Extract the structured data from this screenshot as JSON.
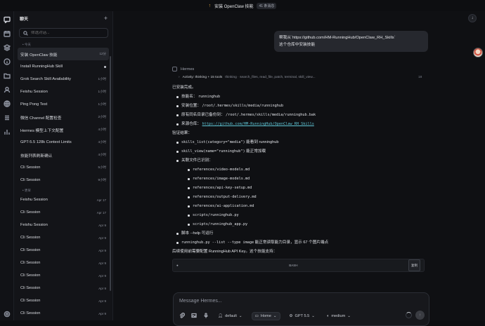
{
  "topbar": {
    "title": "安装 OpenClaw 技能",
    "count": "41 条消息",
    "warn_icon": "pin-icon"
  },
  "sidebar": {
    "title": "聊天",
    "new_label": "+",
    "search_placeholder": "筛选对话...",
    "groups": [
      {
        "label": "• 今天",
        "items": [
          {
            "label": "安装 OpenClaw 技能",
            "time": "12分",
            "selected": true
          },
          {
            "label": "Install RunningHub Skill",
            "time": "",
            "dot": true
          },
          {
            "label": "Grok Search Skill Availability",
            "time": "1小时"
          },
          {
            "label": "Feishu Session",
            "time": "1小时"
          },
          {
            "label": "Ping Pong Test",
            "time": "1小时"
          },
          {
            "label": "微信 Channel 配置检查",
            "time": "2小时"
          },
          {
            "label": "Hermes 模型上下文配置",
            "time": "4小时"
          },
          {
            "label": "GPT-5.5 128k Context Limits",
            "time": "4小时"
          },
          {
            "label": "技能列表刷新确认",
            "time": "4小时"
          },
          {
            "label": "Cli Session",
            "time": "5小时"
          },
          {
            "label": "Cli Session",
            "time": "9小时"
          }
        ]
      },
      {
        "label": "• 更早",
        "items": [
          {
            "label": "Feishu Session",
            "time": "Apr 17"
          },
          {
            "label": "Cli Session",
            "time": "Apr 17"
          },
          {
            "label": "Feishu Session",
            "time": "Apr 9"
          },
          {
            "label": "Cli Session",
            "time": "Apr 9"
          },
          {
            "label": "Cli Session",
            "time": "Apr 9"
          },
          {
            "label": "Cli Session",
            "time": "Apr 9"
          },
          {
            "label": "Cli Session",
            "time": "Apr 9"
          },
          {
            "label": "Cli Session",
            "time": "Apr 9"
          },
          {
            "label": "Cli Session",
            "time": "Apr 9"
          },
          {
            "label": "Cli Session",
            "time": "Apr 9"
          }
        ]
      }
    ]
  },
  "chat": {
    "user_message_line1": "帮我从`https://github.com/HM-RunningHub/OpenClaw_RH_Skills`",
    "user_message_line2": "这个仓库中安装技能",
    "assistant_name": "Hermes",
    "activity_label": "Activity: thinking + 15 tools",
    "activity_detail": "thinking · search_files, read_file, patch, terminal, skill_view...",
    "activity_count": "18",
    "done": "已安装完成。",
    "info": [
      {
        "k": "技能名：",
        "v": "runninghub"
      },
      {
        "k": "安装位置：",
        "v": "/root/.hermes/skills/media/runninghub"
      },
      {
        "k": "原有同名目录已备份到：",
        "v": "/root/.hermes/skills/media/runninghub.bak"
      },
      {
        "k": "来源仓库：",
        "v": "https://github.com/HM-RunningHub/OpenClaw_RH_Skills"
      }
    ],
    "verify_title": "验证结果：",
    "verify1_code": "skills_list(category=\"media\")",
    "verify1_text": "能看到 runninghub",
    "verify2_code": "skill_view(name=\"runninghub\")",
    "verify2_text": "能正常加载",
    "verify3": "关联文件已识别：",
    "files": [
      "references/video-models.md",
      "references/image-models.md",
      "references/api-key-setup.md",
      "references/output-delivery.md",
      "references/ai-application.md",
      "scripts/runninghub.py",
      "scripts/runninghub_app.py"
    ],
    "verify4": "脚本 --help 可运行",
    "verify5_code": "runninghub.py --list --type image",
    "verify5_text": "能正常读取能力目录，显示 67 个图片端点",
    "final": "后续使用前需要配置 RunningHub API Key。这个技能支持：",
    "code_lang": "BASH",
    "copy_label": "复制"
  },
  "composer": {
    "placeholder": "Message Hermes...",
    "profile": "default",
    "folder": "Home",
    "model": "GPT 5.5",
    "effort": "medium"
  }
}
